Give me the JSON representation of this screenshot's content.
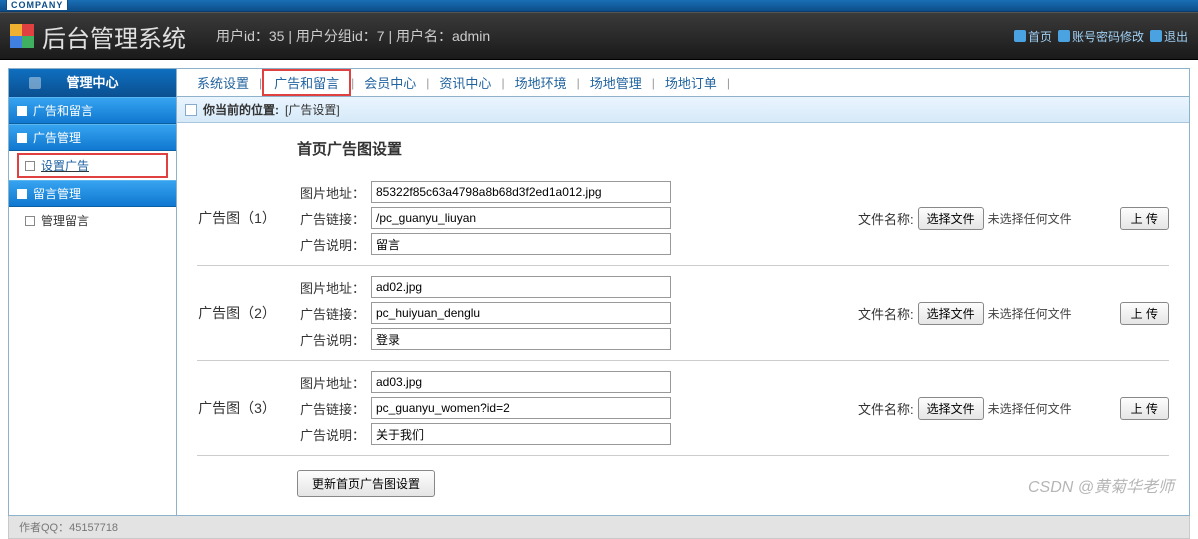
{
  "company_badge": "COMPANY",
  "app_title": "后台管理系统",
  "user_meta": "用户id：35 | 用户分组id：7 | 用户名：admin",
  "header_links": {
    "home": "首页",
    "pwd": "账号密码修改",
    "logout": "退出"
  },
  "sidebar": {
    "center": "管理中心",
    "section_root": "广告和留言",
    "group1": "广告管理",
    "item1": "设置广告",
    "group2": "留言管理",
    "item2": "管理留言"
  },
  "tabs": [
    "系统设置",
    "广告和留言",
    "会员中心",
    "资讯中心",
    "场地环境",
    "场地管理",
    "场地订单"
  ],
  "active_tab_index": 1,
  "breadcrumb": {
    "prefix": "你当前的位置:",
    "current": "[广告设置]"
  },
  "section_title": "首页广告图设置",
  "labels": {
    "img_url": "图片地址：",
    "ad_link": "广告链接：",
    "ad_desc": "广告说明：",
    "file_name": "文件名称:",
    "choose_file": "选择文件",
    "no_file": "未选择任何文件",
    "upload": "上 传",
    "update_all": "更新首页广告图设置"
  },
  "ads": [
    {
      "title": "广告图（1）",
      "img": "85322f85c63a4798a8b68d3f2ed1a012.jpg",
      "link": "/pc_guanyu_liuyan",
      "desc": "留言"
    },
    {
      "title": "广告图（2）",
      "img": "ad02.jpg",
      "link": "pc_huiyuan_denglu",
      "desc": "登录"
    },
    {
      "title": "广告图（3）",
      "img": "ad03.jpg",
      "link": "pc_guanyu_women?id=2",
      "desc": "关于我们"
    }
  ],
  "footer": "作者QQ：45157718",
  "watermark": "CSDN @黄菊华老师"
}
